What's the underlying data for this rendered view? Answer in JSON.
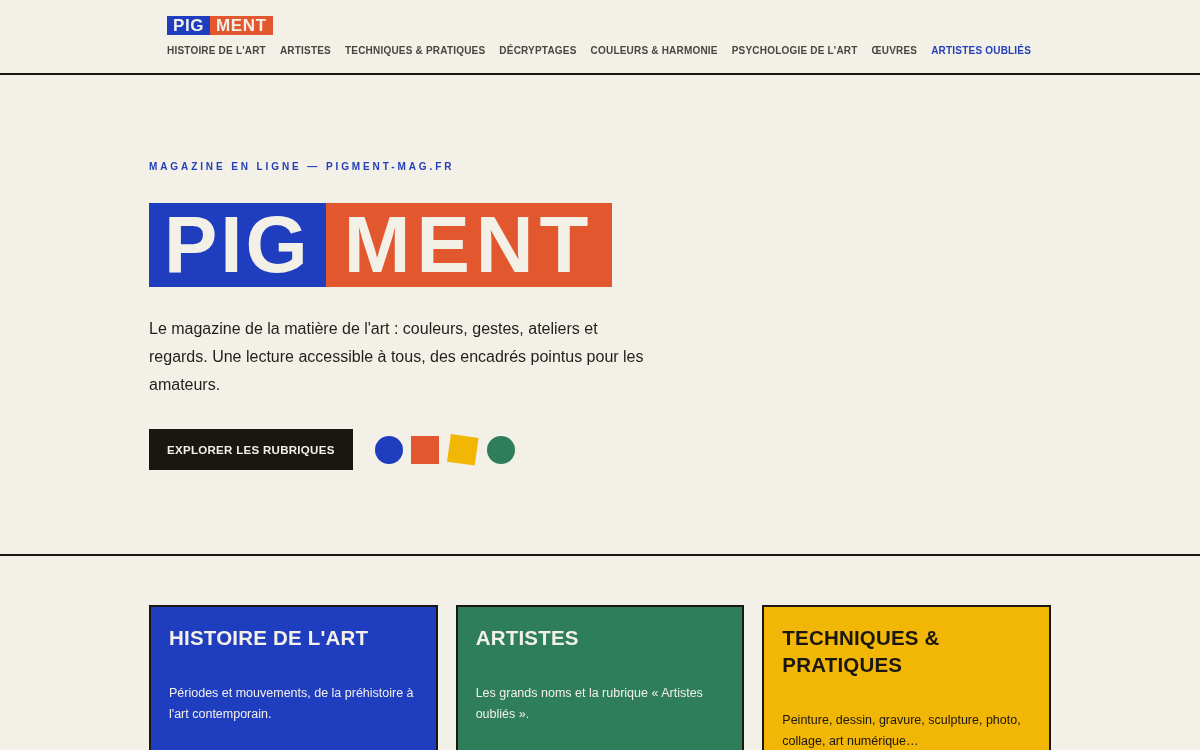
{
  "header": {
    "logo": [
      {
        "text": "PIG",
        "color": "#1f3dbf"
      },
      {
        "text": "MENT",
        "color": "#e2572e"
      }
    ],
    "nav": [
      {
        "label": "HISTOIRE DE L'ART",
        "selected": false
      },
      {
        "label": "ARTISTES",
        "selected": false
      },
      {
        "label": "TECHNIQUES & PRATIQUES",
        "selected": false
      },
      {
        "label": "DÉCRYPTAGES",
        "selected": false
      },
      {
        "label": "COULEURS & HARMONIE",
        "selected": false
      },
      {
        "label": "PSYCHOLOGIE DE L'ART",
        "selected": false
      },
      {
        "label": "ŒUVRES",
        "selected": false
      },
      {
        "label": "ARTISTES OUBLIÉS",
        "selected": true
      }
    ]
  },
  "hero": {
    "eyebrow": "MAGAZINE EN LIGNE — PIGMENT-MAG.FR",
    "title": [
      {
        "text": "PIG",
        "color": "#1f3dbf"
      },
      {
        "text": "MENT",
        "color": "#e2572e"
      }
    ],
    "intro": "Le magazine de la matière de l'art : couleurs, gestes, ateliers et regards. Une lecture accessible à tous, des encadrés pointus pour les amateurs.",
    "button": "EXPLORER LES RUBRIQUES",
    "shapes": [
      {
        "kind": "circle",
        "color": "#1f3dbf"
      },
      {
        "kind": "square",
        "color": "#e2572e"
      },
      {
        "kind": "tilted-square",
        "color": "#f2b705"
      },
      {
        "kind": "circle",
        "color": "#2e7d5b"
      }
    ]
  },
  "sections": [
    {
      "title": "HISTOIRE DE L'ART",
      "description": "Périodes et mouvements, de la préhistoire à l'art contemporain.",
      "color": "#1f3dbf"
    },
    {
      "title": "ARTISTES",
      "description": "Les grands noms et la rubrique « Artistes oubliés ».",
      "color": "#2e7d5b"
    },
    {
      "title": "TECHNIQUES & PRATIQUES",
      "description": "Peinture, dessin, gravure, sculpture, photo, collage, art numérique…",
      "color": "#f2b705"
    }
  ]
}
